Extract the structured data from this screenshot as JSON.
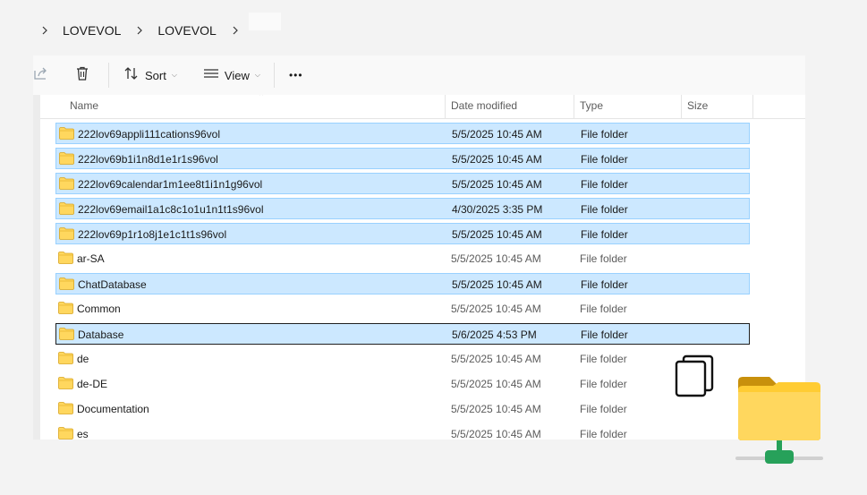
{
  "breadcrumb": {
    "items": [
      "LOVEVOL",
      "LOVEVOL"
    ]
  },
  "toolbar": {
    "sort_label": "Sort",
    "view_label": "View",
    "more_label": "•••",
    "icons": [
      "share-icon",
      "delete-icon",
      "sort-icon",
      "view-icon",
      "more-icon"
    ]
  },
  "columns": {
    "name": "Name",
    "date": "Date modified",
    "type": "Type",
    "size": "Size"
  },
  "rows": [
    {
      "name": "222lov69appli111cations96vol",
      "date": "5/5/2025 10:45 AM",
      "type": "File folder",
      "state": "selected"
    },
    {
      "name": "222lov69b1i1n8d1e1r1s96vol",
      "date": "5/5/2025 10:45 AM",
      "type": "File folder",
      "state": "selected"
    },
    {
      "name": "222lov69calendar1m1ee8t1i1n1g96vol",
      "date": "5/5/2025 10:45 AM",
      "type": "File folder",
      "state": "selected"
    },
    {
      "name": "222lov69email1a1c8c1o1u1n1t1s96vol",
      "date": "4/30/2025 3:35 PM",
      "type": "File folder",
      "state": "selected"
    },
    {
      "name": "222lov69p1r1o8j1e1c1t1s96vol",
      "date": "5/5/2025 10:45 AM",
      "type": "File folder",
      "state": "selected"
    },
    {
      "name": "ar-SA",
      "date": "5/5/2025 10:45 AM",
      "type": "File folder",
      "state": "normal"
    },
    {
      "name": "ChatDatabase",
      "date": "5/5/2025 10:45 AM",
      "type": "File folder",
      "state": "selected"
    },
    {
      "name": "Common",
      "date": "5/5/2025 10:45 AM",
      "type": "File folder",
      "state": "normal"
    },
    {
      "name": "Database",
      "date": "5/6/2025 4:53 PM",
      "type": "File folder",
      "state": "focused"
    },
    {
      "name": "de",
      "date": "5/5/2025 10:45 AM",
      "type": "File folder",
      "state": "normal"
    },
    {
      "name": "de-DE",
      "date": "5/5/2025 10:45 AM",
      "type": "File folder",
      "state": "normal"
    },
    {
      "name": "Documentation",
      "date": "5/5/2025 10:45 AM",
      "type": "File folder",
      "state": "normal"
    },
    {
      "name": "es",
      "date": "5/5/2025 10:45 AM",
      "type": "File folder",
      "state": "normal"
    }
  ],
  "colors": {
    "selection_bg": "#cce8ff",
    "selection_border": "#99d1ff",
    "folder_yellow": "#ffd75e",
    "network_green": "#27a15a"
  }
}
